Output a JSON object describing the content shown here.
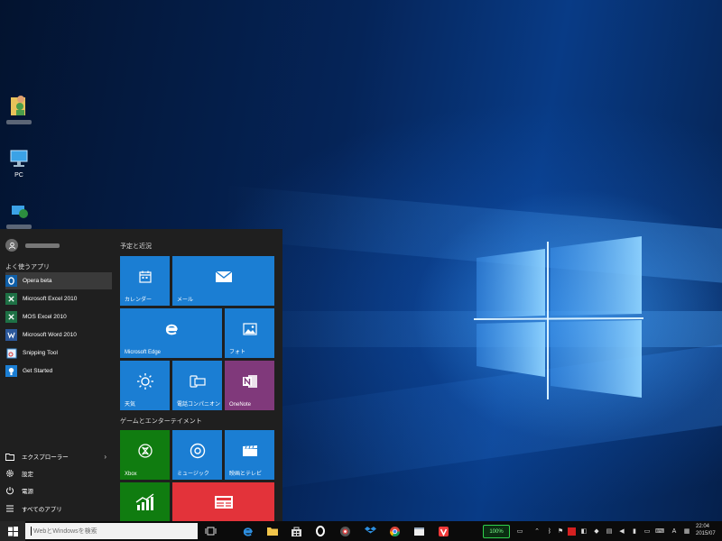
{
  "desktop": {
    "icons": [
      {
        "name": "user-folder",
        "label": ""
      },
      {
        "name": "pc",
        "label": "PC"
      },
      {
        "name": "network",
        "label": ""
      }
    ]
  },
  "start_menu": {
    "user_name": "",
    "most_used_header": "よく使うアプリ",
    "apps": [
      {
        "label": "Opera beta",
        "icon": "opera-icon",
        "color": "#0f5fa8"
      },
      {
        "label": "Microsoft Excel 2010",
        "icon": "excel-icon",
        "color": "#1e7145"
      },
      {
        "label": "MOS Excel 2010",
        "icon": "mos-excel-icon",
        "color": "#1e7145"
      },
      {
        "label": "Microsoft Word 2010",
        "icon": "word-icon",
        "color": "#2b579a"
      },
      {
        "label": "Snipping Tool",
        "icon": "snipping-tool-icon",
        "color": "#3a8fd8"
      },
      {
        "label": "Get Started",
        "icon": "lightbulb-icon",
        "color": "#1b7ed3"
      }
    ],
    "bottom": {
      "explorer": "エクスプローラー",
      "settings": "設定",
      "power": "電源",
      "all_apps": "すべてのアプリ"
    },
    "groups": {
      "schedule": "予定と近況",
      "games": "ゲームとエンターテイメント"
    },
    "tiles": {
      "calendar": "カレンダー",
      "mail": "メール",
      "edge": "Microsoft Edge",
      "photos": "フォト",
      "weather": "天気",
      "phone": "電話コンパニオン",
      "onenote": "OneNote",
      "xbox": "Xbox",
      "music": "ミュージック",
      "movies": "映画とテレビ"
    }
  },
  "taskbar": {
    "search_placeholder": "WebとWindowsを検索",
    "battery": "100%",
    "time": "22:04",
    "date": "2015/07"
  },
  "colors": {
    "tile_blue": "#1b7ed3",
    "xbox_green": "#107c10",
    "onenote_purple": "#80397b",
    "news_red": "#e3333a",
    "taskbar": "#0b0b0b",
    "start_bg": "#1f1f1f"
  }
}
